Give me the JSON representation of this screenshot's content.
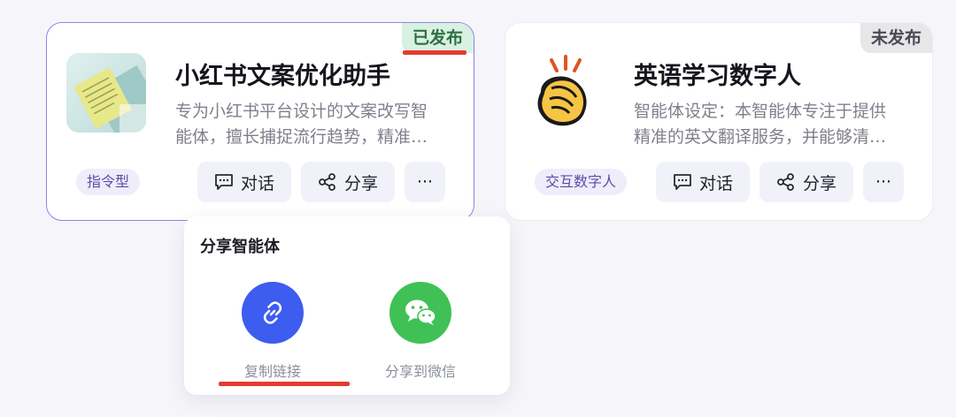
{
  "agents": [
    {
      "title": "小红书文案优化助手",
      "status": "已发布",
      "desc_line1": "专为小红书平台设计的文案改写智",
      "desc_line2": "能体，擅长捕捉流行趋势，精准…",
      "tag": "指令型",
      "chat_label": "对话",
      "share_label": "分享",
      "more_label": "···"
    },
    {
      "title": "英语学习数字人",
      "status": "未发布",
      "desc_line1": "智能体设定：本智能体专注于提供",
      "desc_line2": "精准的英文翻译服务，并能够清…",
      "tag": "交互数字人",
      "chat_label": "对话",
      "share_label": "分享",
      "more_label": "···"
    }
  ],
  "share_popover": {
    "title": "分享智能体",
    "options": [
      {
        "label": "复制链接",
        "icon": "link-icon",
        "color": "#3d5cf0"
      },
      {
        "label": "分享到微信",
        "icon": "wechat-icon",
        "color": "#3fc155"
      }
    ]
  },
  "colors": {
    "accent": "#8f82ea",
    "highlight": "#e53a2f",
    "published_bg": "#d8f1e0",
    "unpublished_bg": "#e7e7ea"
  }
}
